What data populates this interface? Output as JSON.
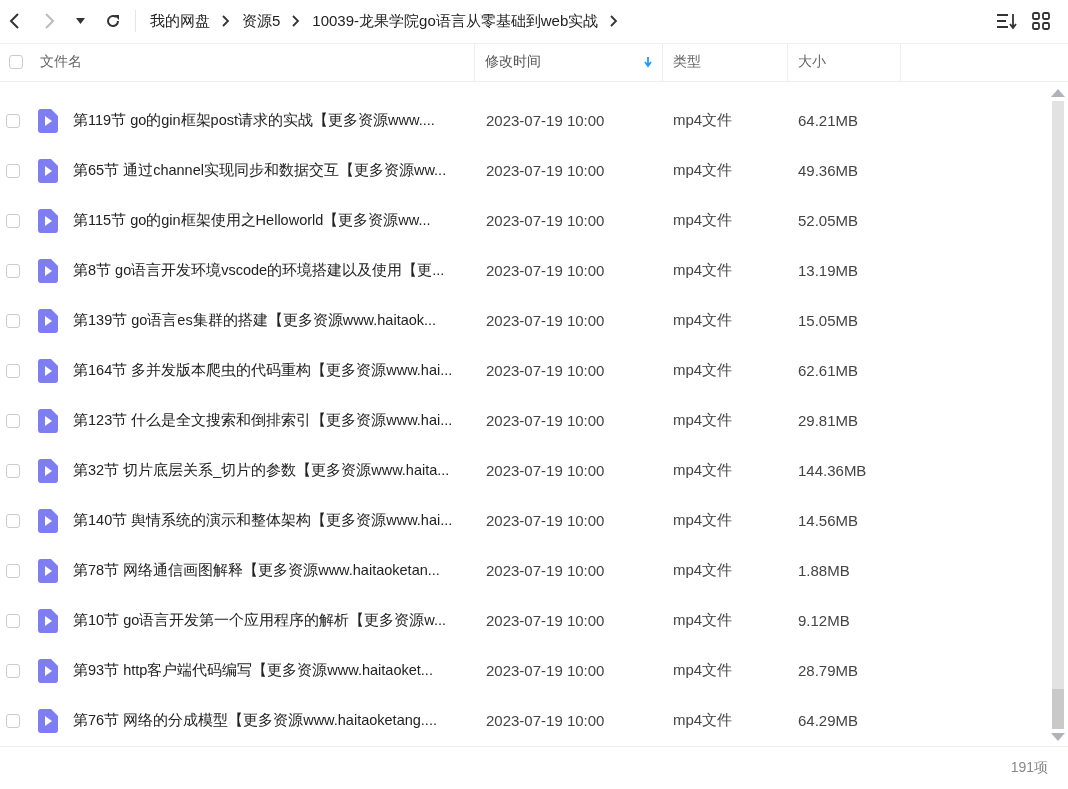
{
  "breadcrumb": [
    "我的网盘",
    "资源5",
    "10039-龙果学院go语言从零基础到web实战"
  ],
  "table": {
    "select_all_checked": false,
    "columns": [
      {
        "label": "文件名",
        "sorted": false
      },
      {
        "label": "修改时间",
        "sorted": true
      },
      {
        "label": "类型",
        "sorted": false
      },
      {
        "label": "大小",
        "sorted": false
      }
    ],
    "rows": [
      {
        "name": "第119节 go的gin框架post请求的实战【更多资源www....",
        "modified": "2023-07-19 10:00",
        "type": "mp4文件",
        "size": "64.21MB",
        "checked": false
      },
      {
        "name": "第65节 通过channel实现同步和数据交互【更多资源ww...",
        "modified": "2023-07-19 10:00",
        "type": "mp4文件",
        "size": "49.36MB",
        "checked": false
      },
      {
        "name": "第115节 go的gin框架使用之Helloworld【更多资源ww...",
        "modified": "2023-07-19 10:00",
        "type": "mp4文件",
        "size": "52.05MB",
        "checked": false
      },
      {
        "name": "第8节 go语言开发环境vscode的环境搭建以及使用【更...",
        "modified": "2023-07-19 10:00",
        "type": "mp4文件",
        "size": "13.19MB",
        "checked": false
      },
      {
        "name": "第139节 go语言es集群的搭建【更多资源www.haitaok...",
        "modified": "2023-07-19 10:00",
        "type": "mp4文件",
        "size": "15.05MB",
        "checked": false
      },
      {
        "name": "第164节 多并发版本爬虫的代码重构【更多资源www.hai...",
        "modified": "2023-07-19 10:00",
        "type": "mp4文件",
        "size": "62.61MB",
        "checked": false
      },
      {
        "name": "第123节 什么是全文搜索和倒排索引【更多资源www.hai...",
        "modified": "2023-07-19 10:00",
        "type": "mp4文件",
        "size": "29.81MB",
        "checked": false
      },
      {
        "name": "第32节 切片底层关系_切片的参数【更多资源www.haita...",
        "modified": "2023-07-19 10:00",
        "type": "mp4文件",
        "size": "144.36MB",
        "checked": false
      },
      {
        "name": "第140节 舆情系统的演示和整体架构【更多资源www.hai...",
        "modified": "2023-07-19 10:00",
        "type": "mp4文件",
        "size": "14.56MB",
        "checked": false
      },
      {
        "name": "第78节 网络通信画图解释【更多资源www.haitaoketan...",
        "modified": "2023-07-19 10:00",
        "type": "mp4文件",
        "size": "1.88MB",
        "checked": false
      },
      {
        "name": "第10节 go语言开发第一个应用程序的解析【更多资源w...",
        "modified": "2023-07-19 10:00",
        "type": "mp4文件",
        "size": "9.12MB",
        "checked": false
      },
      {
        "name": "第93节 http客户端代码编写【更多资源www.haitaoket...",
        "modified": "2023-07-19 10:00",
        "type": "mp4文件",
        "size": "28.79MB",
        "checked": false
      },
      {
        "name": "第76节 网络的分成模型【更多资源www.haitaoketang....",
        "modified": "2023-07-19 10:00",
        "type": "mp4文件",
        "size": "64.29MB",
        "checked": false
      }
    ]
  },
  "status_bar": {
    "count": "191项"
  }
}
